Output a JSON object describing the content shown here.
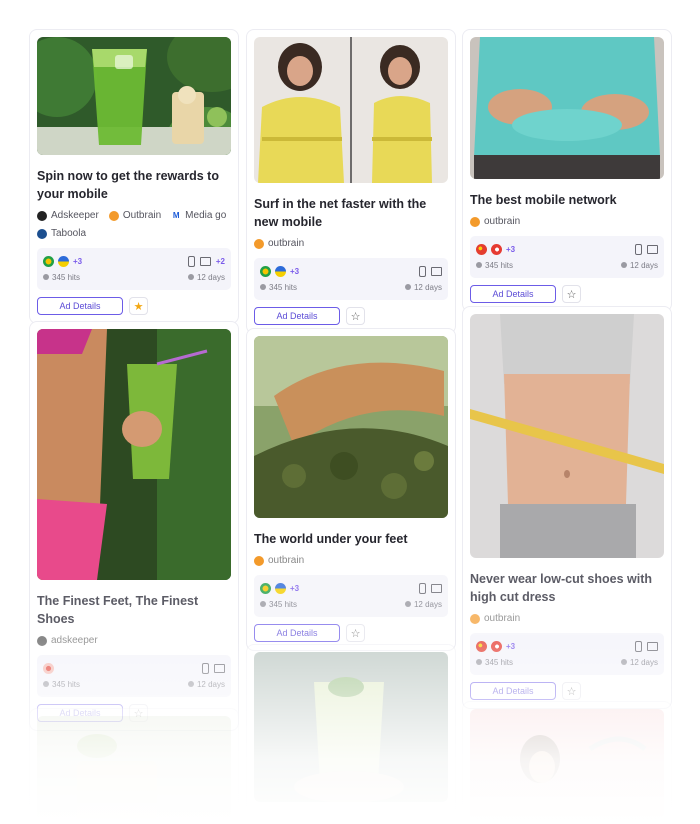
{
  "cards": {
    "c1": {
      "title": "Spin now to get the rewards to your mobile",
      "networks": [
        "Adskeeper",
        "Outbrain",
        "Media go",
        "Taboola"
      ],
      "flags_more": "+3",
      "devices_more": "+2",
      "hits": "345 hits",
      "days": "12 days",
      "details_label": "Ad Details",
      "starred": true
    },
    "c2": {
      "title": "Surf in the net faster with the new mobile",
      "networks": [
        "outbrain"
      ],
      "flags_more": "+3",
      "hits": "345 hits",
      "days": "12 days",
      "details_label": "Ad Details",
      "starred": false
    },
    "c3": {
      "title": "The best mobile network",
      "networks": [
        "outbrain"
      ],
      "flags_more": "+3",
      "hits": "345 hits",
      "days": "12 days",
      "details_label": "Ad Details",
      "starred": false
    },
    "c4": {
      "title": "The Finest Feet, The Finest Shoes",
      "networks": [
        "adskeeper"
      ],
      "hits": "345 hits",
      "days": "12 days",
      "details_label": "Ad Details",
      "starred": false
    },
    "c5": {
      "title": "The world under your feet",
      "networks": [
        "outbrain"
      ],
      "flags_more": "+3",
      "hits": "345 hits",
      "days": "12 days",
      "details_label": "Ad Details",
      "starred": false
    },
    "c6": {
      "title": "Never wear low-cut shoes with high cut dress",
      "networks": [
        "outbrain"
      ],
      "flags_more": "+3",
      "hits": "345 hits",
      "days": "12 days",
      "details_label": "Ad Details",
      "starred": false
    }
  },
  "colors": {
    "accent": "#6c5ce7",
    "star_active": "#f3a712"
  },
  "icons": {
    "star": "☆",
    "star_filled": "★"
  }
}
